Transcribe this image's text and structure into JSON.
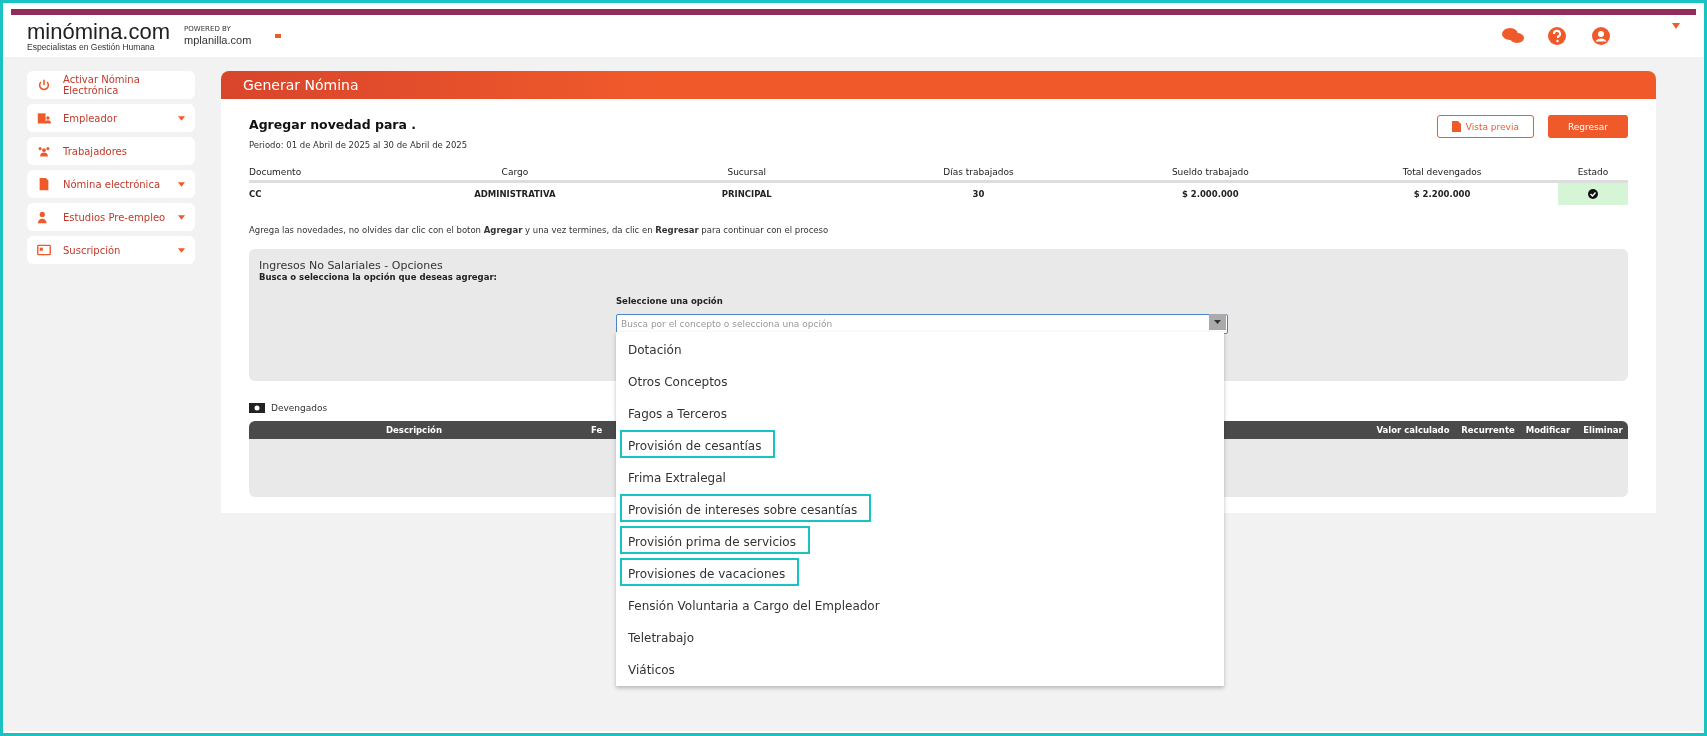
{
  "header": {
    "logo_text": "minómina.com",
    "logo_tagline": "Especialistas en Gestión Humana",
    "powered_by": "POWERED BY",
    "partner": "mplanilla.com"
  },
  "sidebar": {
    "items": [
      {
        "label": "Activar Nómina Electrónica",
        "expandable": false
      },
      {
        "label": "Empleador",
        "expandable": true
      },
      {
        "label": "Trabajadores",
        "expandable": false
      },
      {
        "label": "Nómina electrónica",
        "expandable": true
      },
      {
        "label": "Estudios Pre-empleo",
        "expandable": true
      },
      {
        "label": "Suscripción",
        "expandable": true
      }
    ]
  },
  "panel": {
    "title": "Generar Nómina",
    "heading": "Agregar novedad para .",
    "period": "Periodo: 01 de Abril de 2025 al 30 de Abril de 2025",
    "buttons": [
      {
        "label": "Vista previa",
        "kind": "outline"
      },
      {
        "label": "Regresar",
        "kind": "filled"
      }
    ],
    "summary_table": {
      "columns": [
        "Documento",
        "Cargo",
        "Sucursal",
        "Días trabajados",
        "Sueldo trabajado",
        "Total devengados",
        "Estado"
      ],
      "row": {
        "documento": "CC",
        "cargo": "ADMINISTRATIVA",
        "sucursal": "PRINCIPAL",
        "dias": "30",
        "sueldo": "$ 2.000.000",
        "total": "$ 2.200.000",
        "estado_ok": true
      }
    },
    "instructions": "Agrega las novedades, no olvides dar clic con el boton **Agregar** y una vez termines, da clic en **Regresar** para continuar con el proceso",
    "options": {
      "title": "Ingresos No Salariales - Opciones",
      "subtitle": "Busca o selecciona la opción que deseas agregar:",
      "select_label": "Seleccione una opción",
      "placeholder": "Busca por el concepto o selecciona una opción",
      "dropdown": [
        {
          "label": "Dotación",
          "highlighted": false
        },
        {
          "label": "Otros Conceptos",
          "highlighted": false
        },
        {
          "label": "Fagos a Terceros",
          "highlighted": false
        },
        {
          "label": "Provisión de cesantías",
          "highlighted": true
        },
        {
          "label": "Frima Extralegal",
          "highlighted": false
        },
        {
          "label": "Provisión de intereses sobre cesantías",
          "highlighted": true
        },
        {
          "label": "Provisión prima de servicios",
          "highlighted": true
        },
        {
          "label": "Provisiones de vacaciones",
          "highlighted": true
        },
        {
          "label": "Fensión Voluntaria a Cargo del Empleador",
          "highlighted": false
        },
        {
          "label": "Teletrabajo",
          "highlighted": false
        },
        {
          "label": "Viáticos",
          "highlighted": false
        }
      ]
    },
    "devengados": {
      "title": "Devengados",
      "columns": [
        "Descripción",
        "Fe",
        "Valor calculado",
        "Recurrente",
        "Modificar",
        "Eliminar"
      ]
    }
  }
}
